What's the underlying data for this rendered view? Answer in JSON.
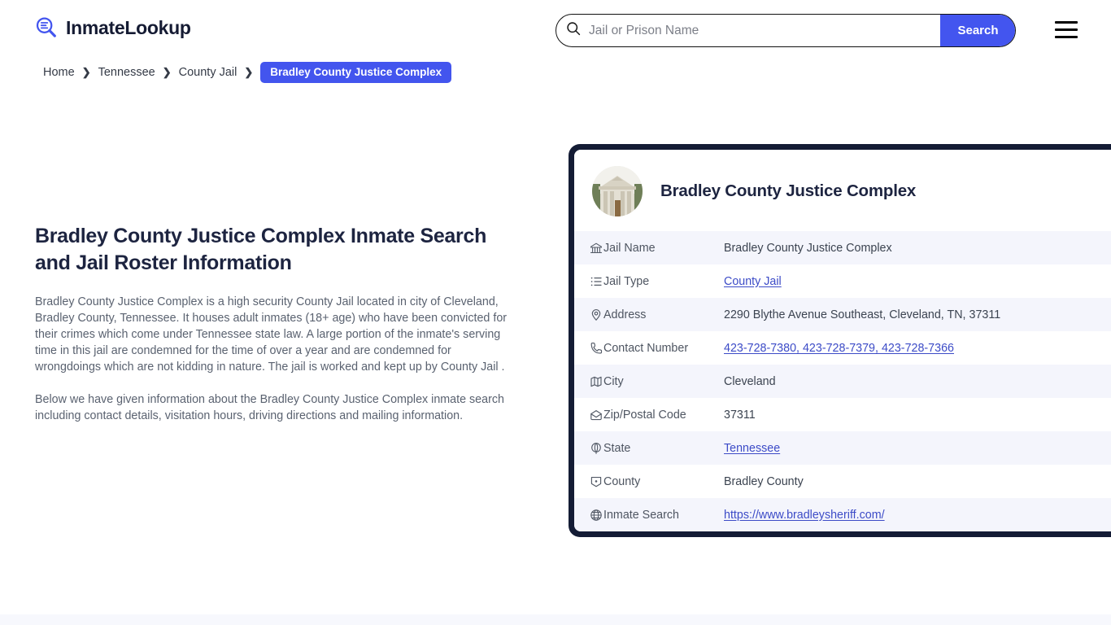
{
  "header": {
    "brand_name": "InmateLookup",
    "brand_icon": "magnifier-list-icon",
    "search": {
      "placeholder": "Jail or Prison Name",
      "value": "",
      "button_label": "Search",
      "icon": "search-icon"
    },
    "menu_icon": "hamburger-menu-icon"
  },
  "breadcrumb": {
    "items": [
      {
        "label": "Home",
        "current": false
      },
      {
        "label": "Tennessee",
        "current": false
      },
      {
        "label": "County Jail",
        "current": false
      },
      {
        "label": "Bradley County Justice Complex",
        "current": true
      }
    ],
    "separator": "❯"
  },
  "main": {
    "title": "Bradley County Justice Complex Inmate Search and Jail Roster Information",
    "paragraph_1": "Bradley County Justice Complex is a high security County Jail located in city of Cleveland, Bradley County, Tennessee. It houses adult inmates (18+ age) who have been convicted for their crimes which come under Tennessee state law. A large portion of the inmate's serving time in this jail are condemned for the time of over a year and are condemned for wrongdoings which are not kidding in nature. The jail is worked and kept up by County Jail .",
    "paragraph_2": "Below we have given information about the Bradley County Justice Complex inmate search including contact details, visitation hours, driving directions and mailing information."
  },
  "card": {
    "photo_alt": "courthouse-photo",
    "title": "Bradley County Justice Complex",
    "rows": [
      {
        "icon": "bank-icon",
        "label": "Jail Name",
        "value": "Bradley County Justice Complex",
        "link": false
      },
      {
        "icon": "list-icon",
        "label": "Jail Type",
        "value": "County Jail",
        "link": true
      },
      {
        "icon": "map-pin-icon",
        "label": "Address",
        "value": "2290 Blythe Avenue Southeast, Cleveland, TN, 37311",
        "link": false
      },
      {
        "icon": "phone-icon",
        "label": "Contact Number",
        "value": "423-728-7380, 423-728-7379, 423-728-7366",
        "link": true
      },
      {
        "icon": "map-icon",
        "label": "City",
        "value": "Cleveland",
        "link": false
      },
      {
        "icon": "envelope-icon",
        "label": "Zip/Postal Code",
        "value": "37311",
        "link": false
      },
      {
        "icon": "globe-pin-icon",
        "label": "State",
        "value": "Tennessee",
        "link": true
      },
      {
        "icon": "county-icon",
        "label": "County",
        "value": "Bradley County",
        "link": false
      },
      {
        "icon": "globe-icon",
        "label": "Inmate Search",
        "value": "https://www.bradleysheriff.com/",
        "link": true
      }
    ]
  },
  "colors": {
    "accent": "#4355ef",
    "badge": "#4355ee",
    "card_border": "#141c35",
    "row_alt": "#f4f5fc",
    "link": "#3c4bc7",
    "heading": "#1d2440",
    "body_text": "#5a6270"
  }
}
